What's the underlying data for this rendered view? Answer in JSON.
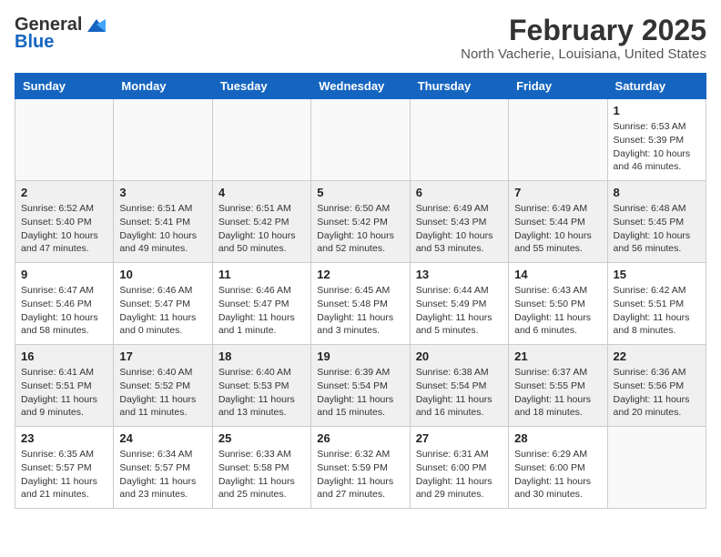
{
  "header": {
    "logo_general": "General",
    "logo_blue": "Blue",
    "title": "February 2025",
    "subtitle": "North Vacherie, Louisiana, United States"
  },
  "calendar": {
    "headers": [
      "Sunday",
      "Monday",
      "Tuesday",
      "Wednesday",
      "Thursday",
      "Friday",
      "Saturday"
    ],
    "weeks": [
      [
        {
          "day": "",
          "info": ""
        },
        {
          "day": "",
          "info": ""
        },
        {
          "day": "",
          "info": ""
        },
        {
          "day": "",
          "info": ""
        },
        {
          "day": "",
          "info": ""
        },
        {
          "day": "",
          "info": ""
        },
        {
          "day": "1",
          "info": "Sunrise: 6:53 AM\nSunset: 5:39 PM\nDaylight: 10 hours and 46 minutes."
        }
      ],
      [
        {
          "day": "2",
          "info": "Sunrise: 6:52 AM\nSunset: 5:40 PM\nDaylight: 10 hours and 47 minutes."
        },
        {
          "day": "3",
          "info": "Sunrise: 6:51 AM\nSunset: 5:41 PM\nDaylight: 10 hours and 49 minutes."
        },
        {
          "day": "4",
          "info": "Sunrise: 6:51 AM\nSunset: 5:42 PM\nDaylight: 10 hours and 50 minutes."
        },
        {
          "day": "5",
          "info": "Sunrise: 6:50 AM\nSunset: 5:42 PM\nDaylight: 10 hours and 52 minutes."
        },
        {
          "day": "6",
          "info": "Sunrise: 6:49 AM\nSunset: 5:43 PM\nDaylight: 10 hours and 53 minutes."
        },
        {
          "day": "7",
          "info": "Sunrise: 6:49 AM\nSunset: 5:44 PM\nDaylight: 10 hours and 55 minutes."
        },
        {
          "day": "8",
          "info": "Sunrise: 6:48 AM\nSunset: 5:45 PM\nDaylight: 10 hours and 56 minutes."
        }
      ],
      [
        {
          "day": "9",
          "info": "Sunrise: 6:47 AM\nSunset: 5:46 PM\nDaylight: 10 hours and 58 minutes."
        },
        {
          "day": "10",
          "info": "Sunrise: 6:46 AM\nSunset: 5:47 PM\nDaylight: 11 hours and 0 minutes."
        },
        {
          "day": "11",
          "info": "Sunrise: 6:46 AM\nSunset: 5:47 PM\nDaylight: 11 hours and 1 minute."
        },
        {
          "day": "12",
          "info": "Sunrise: 6:45 AM\nSunset: 5:48 PM\nDaylight: 11 hours and 3 minutes."
        },
        {
          "day": "13",
          "info": "Sunrise: 6:44 AM\nSunset: 5:49 PM\nDaylight: 11 hours and 5 minutes."
        },
        {
          "day": "14",
          "info": "Sunrise: 6:43 AM\nSunset: 5:50 PM\nDaylight: 11 hours and 6 minutes."
        },
        {
          "day": "15",
          "info": "Sunrise: 6:42 AM\nSunset: 5:51 PM\nDaylight: 11 hours and 8 minutes."
        }
      ],
      [
        {
          "day": "16",
          "info": "Sunrise: 6:41 AM\nSunset: 5:51 PM\nDaylight: 11 hours and 9 minutes."
        },
        {
          "day": "17",
          "info": "Sunrise: 6:40 AM\nSunset: 5:52 PM\nDaylight: 11 hours and 11 minutes."
        },
        {
          "day": "18",
          "info": "Sunrise: 6:40 AM\nSunset: 5:53 PM\nDaylight: 11 hours and 13 minutes."
        },
        {
          "day": "19",
          "info": "Sunrise: 6:39 AM\nSunset: 5:54 PM\nDaylight: 11 hours and 15 minutes."
        },
        {
          "day": "20",
          "info": "Sunrise: 6:38 AM\nSunset: 5:54 PM\nDaylight: 11 hours and 16 minutes."
        },
        {
          "day": "21",
          "info": "Sunrise: 6:37 AM\nSunset: 5:55 PM\nDaylight: 11 hours and 18 minutes."
        },
        {
          "day": "22",
          "info": "Sunrise: 6:36 AM\nSunset: 5:56 PM\nDaylight: 11 hours and 20 minutes."
        }
      ],
      [
        {
          "day": "23",
          "info": "Sunrise: 6:35 AM\nSunset: 5:57 PM\nDaylight: 11 hours and 21 minutes."
        },
        {
          "day": "24",
          "info": "Sunrise: 6:34 AM\nSunset: 5:57 PM\nDaylight: 11 hours and 23 minutes."
        },
        {
          "day": "25",
          "info": "Sunrise: 6:33 AM\nSunset: 5:58 PM\nDaylight: 11 hours and 25 minutes."
        },
        {
          "day": "26",
          "info": "Sunrise: 6:32 AM\nSunset: 5:59 PM\nDaylight: 11 hours and 27 minutes."
        },
        {
          "day": "27",
          "info": "Sunrise: 6:31 AM\nSunset: 6:00 PM\nDaylight: 11 hours and 29 minutes."
        },
        {
          "day": "28",
          "info": "Sunrise: 6:29 AM\nSunset: 6:00 PM\nDaylight: 11 hours and 30 minutes."
        },
        {
          "day": "",
          "info": ""
        }
      ]
    ]
  }
}
